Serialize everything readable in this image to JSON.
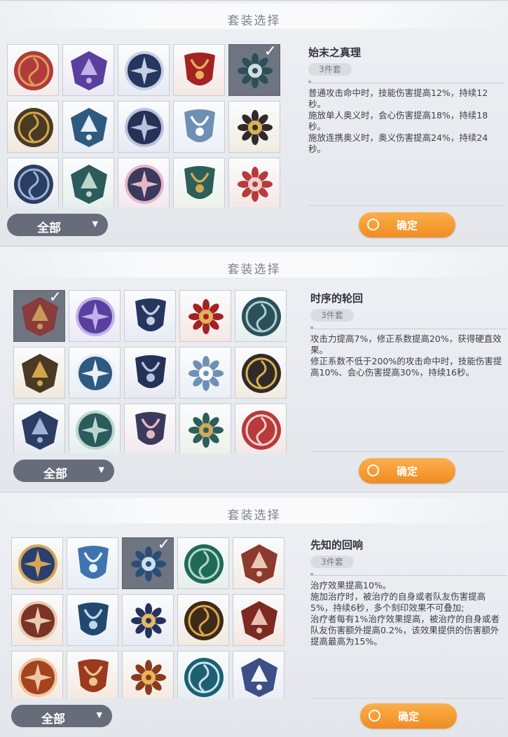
{
  "panels": [
    {
      "header": {
        "title": "套装选择"
      },
      "filter": {
        "label": "全部"
      },
      "set": {
        "name": "始末之真理",
        "pieces": "3件套",
        "desc": [
          "普通攻击命中时，技能伤害提高12%，持续12秒。",
          "施放单人奥义时，会心伤害提高18%，持续18秒。",
          "施放连携奥义时，奥义伤害提高24%，持续24秒。"
        ]
      },
      "confirm": {
        "label": "确定"
      },
      "icons": [
        {
          "name": "crimson-swirl-crest-icon",
          "bg": "#f4eceb",
          "fg": "#b33a3a",
          "accent": "#d9a15a",
          "selected": false
        },
        {
          "name": "violet-crystal-spire-icon",
          "bg": "#ece9f6",
          "fg": "#5b3f9e",
          "accent": "#c0b3ea",
          "selected": false
        },
        {
          "name": "navy-compass-ring-icon",
          "bg": "#e7ebf3",
          "fg": "#27365f",
          "accent": "#c7cfe2",
          "selected": false
        },
        {
          "name": "red-horned-shield-icon",
          "bg": "#f4e8e4",
          "fg": "#a52222",
          "accent": "#e2b15a",
          "selected": false
        },
        {
          "name": "teal-lotus-emblem-icon",
          "bg": "#6e7480",
          "fg": "#2c4f58",
          "accent": "#cfdfe0",
          "selected": true
        },
        {
          "name": "gold-lotus-mask-icon",
          "bg": "#efe9de",
          "fg": "#4a3a24",
          "accent": "#d4a64c",
          "selected": false
        },
        {
          "name": "icy-mountain-orb-icon",
          "bg": "#e8eef4",
          "fg": "#2f5a80",
          "accent": "#e7f0f8",
          "selected": false
        },
        {
          "name": "indigo-wolf-moon-icon",
          "bg": "#e8eaf1",
          "fg": "#233256",
          "accent": "#b7c2de",
          "selected": false
        },
        {
          "name": "white-glacier-star-icon",
          "bg": "#eaf0f5",
          "fg": "#6e90b4",
          "accent": "#ffffff",
          "selected": false
        },
        {
          "name": "black-gold-pyramid-icon",
          "bg": "#f1ece2",
          "fg": "#302a2a",
          "accent": "#d8b24f",
          "selected": false
        },
        {
          "name": "steel-blue-trident-shield-icon",
          "bg": "#e6eaf0",
          "fg": "#2c3d64",
          "accent": "#9db4d6",
          "selected": false
        },
        {
          "name": "jade-dragon-coil-icon",
          "bg": "#e6efec",
          "fg": "#2b5b5a",
          "accent": "#b9d7cf",
          "selected": false
        },
        {
          "name": "pink-blade-pinwheel-icon",
          "bg": "#f1e9ee",
          "fg": "#3a3b5c",
          "accent": "#e6b6c7",
          "selected": false
        },
        {
          "name": "pharaoh-seal-icon",
          "bg": "#edf2ea",
          "fg": "#2c5e5a",
          "accent": "#d3a955",
          "selected": false
        },
        {
          "name": "crossed-swords-shield-icon",
          "bg": "#f4e6e6",
          "fg": "#b83a3a",
          "accent": "#f1d2cf",
          "selected": false
        }
      ]
    },
    {
      "header": {
        "title": "套装选择"
      },
      "filter": {
        "label": "全部"
      },
      "set": {
        "name": "时序的轮回",
        "pieces": "3件套",
        "desc": [
          "攻击力提高7%，修正系数提高20%，获得硬直效果。",
          "修正系数不低于200%的攻击命中时，技能伤害提高10%、会心伤害提高30%，持续16秒。"
        ]
      },
      "confirm": {
        "label": "确定"
      },
      "icons": [
        {
          "name": "crimson-swirl-crest-icon",
          "bg": "#6e7480",
          "fg": "#8a3b3b",
          "accent": "#c79a5a",
          "selected": true
        },
        {
          "name": "violet-crystal-spire-icon",
          "bg": "#ece9f6",
          "fg": "#5b3f9e",
          "accent": "#c0b3ea",
          "selected": false
        },
        {
          "name": "navy-compass-ring-icon",
          "bg": "#e7ebf3",
          "fg": "#27365f",
          "accent": "#c7cfe2",
          "selected": false
        },
        {
          "name": "red-horned-shield-icon",
          "bg": "#f4e8e4",
          "fg": "#a52222",
          "accent": "#e2b15a",
          "selected": false
        },
        {
          "name": "teal-lotus-emblem-icon",
          "bg": "#e6efef",
          "fg": "#2c4f58",
          "accent": "#a9d0d4",
          "selected": false
        },
        {
          "name": "gold-lotus-mask-icon",
          "bg": "#efe9de",
          "fg": "#4a3a24",
          "accent": "#d4a64c",
          "selected": false
        },
        {
          "name": "icy-mountain-orb-icon",
          "bg": "#e8eef4",
          "fg": "#2f5a80",
          "accent": "#e7f0f8",
          "selected": false
        },
        {
          "name": "indigo-wolf-moon-icon",
          "bg": "#e8eaf1",
          "fg": "#233256",
          "accent": "#b7c2de",
          "selected": false
        },
        {
          "name": "white-glacier-star-icon",
          "bg": "#eaf0f5",
          "fg": "#6e90b4",
          "accent": "#ffffff",
          "selected": false
        },
        {
          "name": "black-gold-pyramid-icon",
          "bg": "#f1ece2",
          "fg": "#302a2a",
          "accent": "#d8b24f",
          "selected": false
        },
        {
          "name": "steel-blue-trident-shield-icon",
          "bg": "#e6eaf0",
          "fg": "#2c3d64",
          "accent": "#9db4d6",
          "selected": false
        },
        {
          "name": "jade-dragon-coil-icon",
          "bg": "#e6efec",
          "fg": "#2b5b5a",
          "accent": "#b9d7cf",
          "selected": false
        },
        {
          "name": "pink-blade-pinwheel-icon",
          "bg": "#f1e9ee",
          "fg": "#3a3b5c",
          "accent": "#e6b6c7",
          "selected": false
        },
        {
          "name": "pharaoh-seal-icon",
          "bg": "#edf2ea",
          "fg": "#2c5e5a",
          "accent": "#d3a955",
          "selected": false
        },
        {
          "name": "crossed-swords-shield-icon",
          "bg": "#f4e6e6",
          "fg": "#b83a3a",
          "accent": "#f1d2cf",
          "selected": false
        }
      ]
    },
    {
      "header": {
        "title": "套装选择"
      },
      "filter": {
        "label": "全部"
      },
      "set": {
        "name": "先知的回响",
        "pieces": "3件套",
        "desc": [
          "治疗效果提高10%。",
          "施加治疗时，被治疗的自身或者队友伤害提高5%，持续6秒，多个刻印效果不可叠加;",
          "治疗者每有1%治疗效果提高，被治疗的自身或者队友伤害额外提高0.2%，该效果提供的伤害额外提高最高为15%。"
        ]
      },
      "confirm": {
        "label": "确定"
      },
      "icons": [
        {
          "name": "starry-peak-medallion-icon",
          "bg": "#efe6d8",
          "fg": "#27406f",
          "accent": "#d9a45a",
          "selected": false
        },
        {
          "name": "blue-spear-hexagon-icon",
          "bg": "#e8eef5",
          "fg": "#3e74b0",
          "accent": "#e9f1fa",
          "selected": false
        },
        {
          "name": "sun-whale-medallion-icon",
          "bg": "#6e7480",
          "fg": "#2b4e78",
          "accent": "#cde0ef",
          "selected": true
        },
        {
          "name": "green-maiden-profile-icon",
          "bg": "#e4efeb",
          "fg": "#1f6a55",
          "accent": "#b2d8c9",
          "selected": false
        },
        {
          "name": "flame-wreath-medallion-icon",
          "bg": "#f3ebe6",
          "fg": "#8c3a2e",
          "accent": "#e9c9b5",
          "selected": false
        },
        {
          "name": "owl-mask-medallion-icon",
          "bg": "#f3e9e2",
          "fg": "#7a3325",
          "accent": "#e8cbb5",
          "selected": false
        },
        {
          "name": "blue-wave-ring-icon",
          "bg": "#e8eef5",
          "fg": "#21496f",
          "accent": "#bcd6ee",
          "selected": false
        },
        {
          "name": "navy-orb-scepter-icon",
          "bg": "#e8ebf2",
          "fg": "#25325d",
          "accent": "#e5b866",
          "selected": false
        },
        {
          "name": "golden-scales-medallion-icon",
          "bg": "#f1eadf",
          "fg": "#3d2a1a",
          "accent": "#d9a64a",
          "selected": false
        },
        {
          "name": "ram-horn-medallion-icon",
          "bg": "#f4e6e2",
          "fg": "#7d2a22",
          "accent": "#eac0b4",
          "selected": false
        },
        {
          "name": "radiant-arch-medallion-icon",
          "bg": "#f3e9e0",
          "fg": "#a5431f",
          "accent": "#efc7a3",
          "selected": false
        },
        {
          "name": "phoenix-medallion-icon",
          "bg": "#f4e7de",
          "fg": "#9b3a1e",
          "accent": "#f0c58b",
          "selected": false
        },
        {
          "name": "golden-sun-medallion-icon",
          "bg": "#f3e9df",
          "fg": "#8a3b1e",
          "accent": "#e9b45a",
          "selected": false
        },
        {
          "name": "teal-dragon-medallion-icon",
          "bg": "#e3eef0",
          "fg": "#1e5f73",
          "accent": "#c8e6ef",
          "selected": false
        },
        {
          "name": "white-tiger-medallion-icon",
          "bg": "#e8ecf4",
          "fg": "#3d4f86",
          "accent": "#f2f5fb",
          "selected": false
        }
      ]
    }
  ]
}
